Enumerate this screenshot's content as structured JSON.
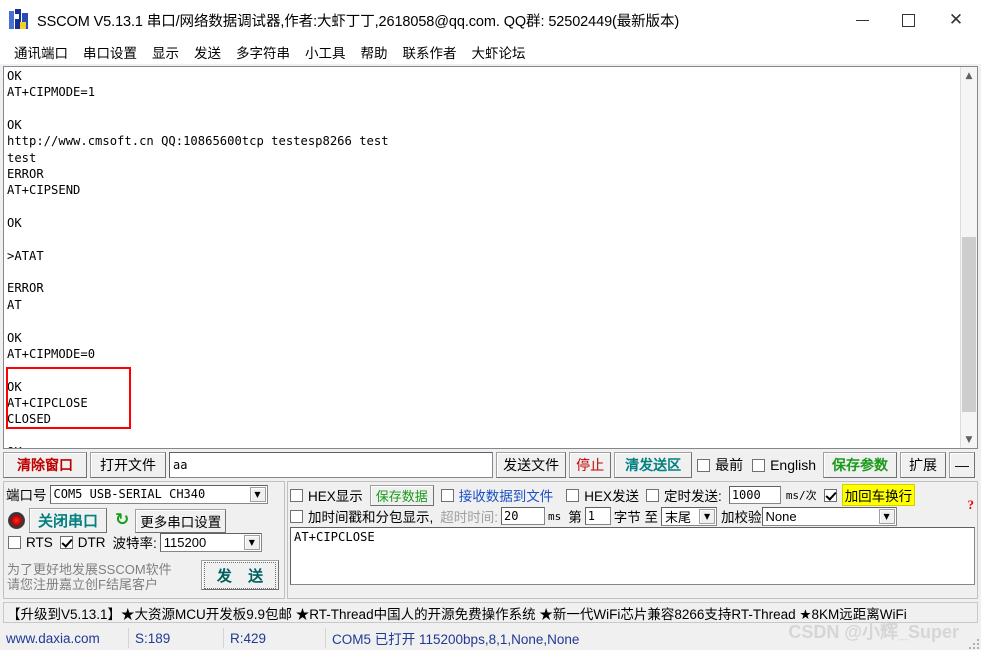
{
  "window": {
    "title": "SSCOM V5.13.1 串口/网络数据调试器,作者:大虾丁丁,2618058@qq.com. QQ群: 52502449(最新版本)",
    "icon": "sscom-app-icon",
    "minimize": "–",
    "maximize": "▢",
    "close": "✕"
  },
  "menu": {
    "items": [
      {
        "label": "通讯端口"
      },
      {
        "label": "串口设置"
      },
      {
        "label": "显示"
      },
      {
        "label": "发送"
      },
      {
        "label": "多字符串"
      },
      {
        "label": "小工具"
      },
      {
        "label": "帮助"
      },
      {
        "label": "联系作者"
      },
      {
        "label": "大虾论坛"
      }
    ]
  },
  "terminal": {
    "content": "OK\nAT+CIPMODE=1\n\nOK\nhttp://www.cmsoft.cn QQ:10865600tcp testesp8266 test\ntest\nERROR\nAT+CIPSEND\n\nOK\n\n>ATAT\n\nERROR\nAT\n\nOK\nAT+CIPMODE=0\n\nOK\nAT+CIPCLOSE\nCLOSED\n\nOK\n",
    "highlight_color": "#ff0000",
    "scrollbar": {
      "up_arrow": "︿",
      "down_arrow": "﹀"
    }
  },
  "toolbar": {
    "clear_window": "清除窗口",
    "open_file": "打开文件",
    "file_path_value": "aa",
    "send_file": "发送文件",
    "stop": "停止",
    "clear_send": "清发送区",
    "topmost": "最前",
    "english": "English",
    "save_params": "保存参数",
    "expand": "扩展",
    "minus": "—"
  },
  "port_panel": {
    "port_label": "端口号",
    "port_value": "COM5 USB-SERIAL CH340",
    "close_port_button": "关闭串口",
    "refresh_icon": "↻",
    "more_settings": "更多串口设置",
    "rts_label": "RTS",
    "rts_checked": false,
    "dtr_label": "DTR",
    "dtr_checked": true,
    "baud_label": "波特率:",
    "baud_value": "115200",
    "hint_line1": "为了更好地发展SSCOM软件",
    "hint_line2": "请您注册嘉立创F结尾客户",
    "send_button": "发 送"
  },
  "options_panel": {
    "hex_display": "HEX显示",
    "hex_display_checked": false,
    "save_data": "保存数据",
    "recv_to_file": "接收数据到文件",
    "recv_to_file_checked": false,
    "hex_send": "HEX发送",
    "hex_send_checked": false,
    "timed_send": "定时发送:",
    "timed_send_checked": false,
    "timed_send_value": "1000",
    "timed_send_unit": "ms/次",
    "crlf": "加回车换行",
    "crlf_checked": true,
    "timestamp_pack": "加时间戳和分包显示,",
    "timestamp_pack_checked": false,
    "timeout_label": "超时时间:",
    "timeout_value": "20",
    "timeout_unit": "ms",
    "byte_from_label": "第",
    "byte_from_value": "1",
    "byte_mid_label": "字节 至",
    "byte_to_value": "末尾",
    "checksum_label": "加校验",
    "checksum_value": "None",
    "help_icon": "?",
    "send_text": "AT+CIPCLOSE"
  },
  "banner": {
    "text": "【升级到V5.13.1】★大资源MCU开发板9.9包邮 ★RT-Thread中国人的开源免费操作系统 ★新一代WiFi芯片兼容8266支持RT-Thread ★8KM远距离WiFi"
  },
  "statusbar": {
    "website": "www.daxia.com",
    "sent": "S:189",
    "received": "R:429",
    "connection": "COM5 已打开  115200bps,8,1,None,None"
  },
  "watermark": "CSDN @小辉_Super",
  "colors": {
    "accent_red": "#c00000",
    "accent_teal": "#008080",
    "accent_green": "#1a9a1a",
    "highlight_yellow": "#ffff00",
    "status_blue": "#1f3a93"
  }
}
